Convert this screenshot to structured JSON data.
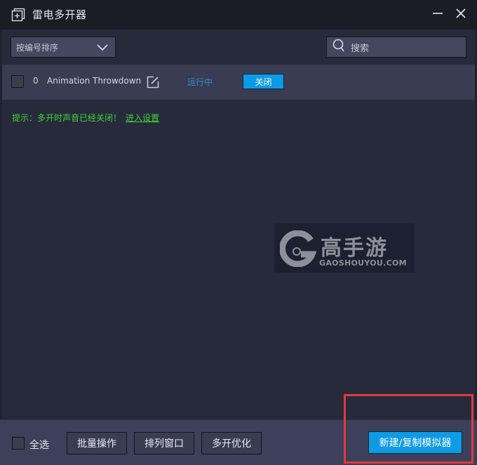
{
  "window": {
    "title": "雷电多开器",
    "minimize_icon": "minus-icon",
    "close_icon": "close-icon"
  },
  "toolbar": {
    "sort_select": {
      "value": "按编号排序",
      "icon": "chevron-down-icon"
    },
    "search": {
      "placeholder": "搜索",
      "icon": "search-icon"
    }
  },
  "instances": [
    {
      "index": "0",
      "name": "Animation Throwdown",
      "edit_icon": "edit-icon",
      "status": "运行中",
      "action_label": "关闭"
    }
  ],
  "hint": {
    "text": "提示：多开时声音已经关闭！",
    "link": "进入设置"
  },
  "watermark": {
    "brand": "高手游",
    "domain": "GAOSHOUYOU.COM"
  },
  "footer": {
    "select_all_label": "全选",
    "buttons": [
      "批量操作",
      "排列窗口",
      "多开优化"
    ],
    "create_label": "新建/复制模拟器"
  },
  "colors": {
    "accent": "#0e9be6",
    "status_running": "#2a8fd0",
    "hint": "#3fd23a",
    "highlight": "#e0393e"
  }
}
